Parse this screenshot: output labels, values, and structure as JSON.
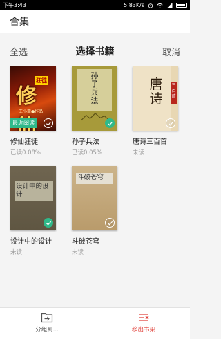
{
  "status_bar": {
    "time": "下午3:43",
    "network_speed": "5.83K/s"
  },
  "header": {
    "title": "合集"
  },
  "select_bar": {
    "select_all": "全选",
    "title": "选择书籍",
    "cancel": "取消"
  },
  "books": [
    {
      "title": "修仙狂徒",
      "progress": "已读0.08%",
      "badge": "最近阅读",
      "checked": false,
      "cover": {
        "big_text": "修仙",
        "tag": "狂徒",
        "author": "王小蛮●作品"
      }
    },
    {
      "title": "孙子兵法",
      "progress": "已读0.05%",
      "checked": true,
      "cover": {
        "text": "孙子兵法"
      }
    },
    {
      "title": "唐诗三百首",
      "progress": "未读",
      "checked": false,
      "cover": {
        "text": "唐诗",
        "tag": "三百首"
      }
    },
    {
      "title": "设计中的设计",
      "progress": "未读",
      "checked": true,
      "cover": {
        "text": "设计中的设计"
      }
    },
    {
      "title": "斗破苍穹",
      "progress": "未读",
      "checked": false,
      "cover": {
        "text": "斗破苍穹"
      }
    }
  ],
  "bottom_bar": {
    "group_label": "分组到...",
    "remove_label": "移出书架"
  },
  "colors": {
    "accent_green": "#2fb98a",
    "remove_red": "#e0403a"
  },
  "icons": {
    "check": "check-icon",
    "move_to_group": "folder-arrow-icon",
    "remove_from_shelf": "shelf-remove-icon"
  }
}
